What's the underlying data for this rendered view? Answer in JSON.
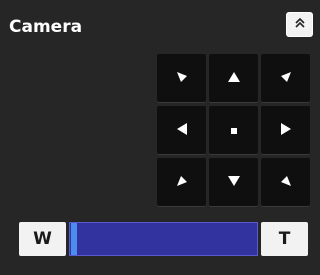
{
  "panel": {
    "title": "Camera"
  },
  "icons": {
    "collapse": "chevron-double-up-icon",
    "up_left": "arrow-up-left-icon",
    "up": "arrow-up-icon",
    "up_right": "arrow-up-right-icon",
    "left": "arrow-left-icon",
    "home": "home-square-icon",
    "right": "arrow-right-icon",
    "down_left": "arrow-down-left-icon",
    "down": "arrow-down-icon",
    "down_right": "arrow-down-right-icon"
  },
  "zoom": {
    "wide_label": "W",
    "tele_label": "T",
    "position": 0.0
  },
  "colors": {
    "background": "#262626",
    "ptz_button": "#0f0f0f",
    "zoom_track": "#3333a0",
    "zoom_thumb": "#4a8cf0",
    "light_button": "#f2f2f2"
  }
}
